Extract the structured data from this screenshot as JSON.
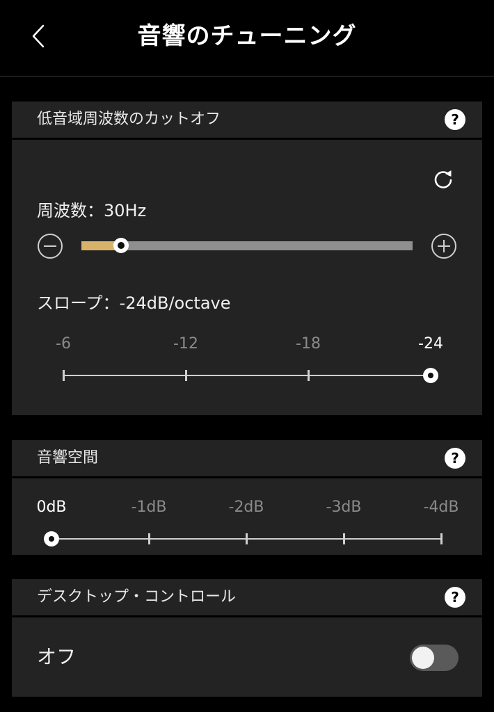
{
  "header": {
    "title": "音響のチューニング",
    "back_icon": "chevron-left-icon"
  },
  "cutoff": {
    "title": "低音域周波数のカットオフ",
    "help": "?",
    "reset_icon": "refresh-icon",
    "frequency_label": "周波数：30Hz",
    "frequency_level": 0.12,
    "minus_icon": "minus-circle-icon",
    "plus_icon": "plus-circle-icon",
    "slope_label": "スロープ：-24dB/octave",
    "slope_options": [
      "-6",
      "-12",
      "-18",
      "-24"
    ],
    "slope_selected": 3
  },
  "sound_space": {
    "title": "音響空間",
    "help": "?",
    "options": [
      "0dB",
      "-1dB",
      "-2dB",
      "-3dB",
      "-4dB"
    ],
    "selected": 0
  },
  "desktop_control": {
    "title": "デスクトップ・コントロール",
    "help": "?",
    "value_label": "オフ",
    "enabled": false
  },
  "colors": {
    "background": "#000000",
    "panel": "#232323",
    "accent": "#d9b26a",
    "track": "#8f8f8f"
  }
}
